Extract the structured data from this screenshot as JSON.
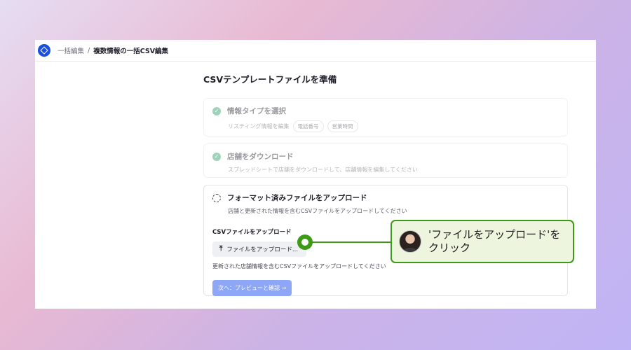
{
  "breadcrumb": {
    "parent": "一括編集",
    "separator": "/",
    "current": "複数情報の一括CSV編集"
  },
  "page": {
    "title": "CSVテンプレートファイルを準備"
  },
  "steps": [
    {
      "title": "情報タイプを選択",
      "description": "リスティング情報を編集",
      "chips": [
        "電話番号",
        "営業時間"
      ],
      "status": "done"
    },
    {
      "title": "店舗をダウンロード",
      "description": "スプレッドシートで店舗をダウンロードして、店舗情報を編集してください",
      "status": "done"
    },
    {
      "title": "フォーマット済みファイルをアップロード",
      "description": "店舗と更新された情報を含むCSVファイルをアップロードしてください",
      "status": "pending",
      "upload_label": "CSVファイルをアップロード",
      "upload_button": "ファイルをアップロード...",
      "upload_help": "更新された店舗情報を含むCSVファイルをアップロードしてください",
      "next_button": "次へ：プレビューと確認 →"
    }
  ],
  "callout": {
    "line1": "'ファイルをアップロード'を",
    "line2": "クリック"
  },
  "colors": {
    "brand": "#1a4fe0",
    "success": "#2d9d6c",
    "primary_button": "#8ea6f6",
    "callout_border": "#3c9a16",
    "callout_bg": "#eef5de"
  },
  "icons": {
    "logo": "brand-logo-icon",
    "done": "check-circle-icon",
    "pending": "dashed-circle-icon",
    "upload": "upload-icon"
  }
}
